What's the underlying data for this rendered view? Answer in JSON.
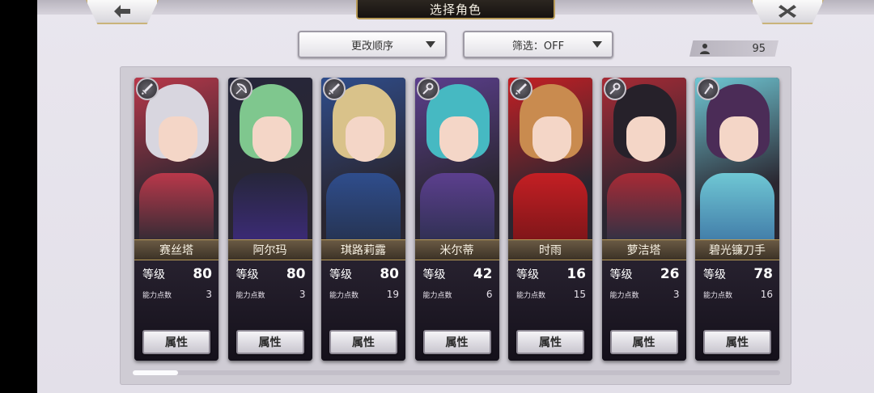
{
  "header": {
    "title": "选择角色",
    "back_icon": "arrow-left-icon",
    "close_icon": "close-icon"
  },
  "controls": {
    "sort_label": "更改顺序",
    "filter_label": "筛选：OFF",
    "unit_count": "95"
  },
  "labels": {
    "level": "等级",
    "ability_points": "能力点数",
    "attribute_button": "属性"
  },
  "characters": [
    {
      "name": "赛丝塔",
      "level": "80",
      "ability_points": "3",
      "weapon_icon": "sword-icon",
      "hair": "#d8d6df",
      "accent": "#b9384a",
      "outfit": "#2b2a33"
    },
    {
      "name": "阿尔玛",
      "level": "80",
      "ability_points": "3",
      "weapon_icon": "bow-icon",
      "hair": "#7fc78e",
      "accent": "#26263a",
      "outfit": "#3d2b7a"
    },
    {
      "name": "琪路莉露",
      "level": "80",
      "ability_points": "19",
      "weapon_icon": "sword-icon",
      "hair": "#d9c28a",
      "accent": "#2f4d8c",
      "outfit": "#25324f"
    },
    {
      "name": "米尔蒂",
      "level": "42",
      "ability_points": "6",
      "weapon_icon": "staff-icon",
      "hair": "#46b9c2",
      "accent": "#5c3f8e",
      "outfit": "#2d2f4f"
    },
    {
      "name": "时雨",
      "level": "16",
      "ability_points": "15",
      "weapon_icon": "sword-icon",
      "hair": "#c98b4f",
      "accent": "#c41f24",
      "outfit": "#7a1518"
    },
    {
      "name": "萝洁塔",
      "level": "26",
      "ability_points": "3",
      "weapon_icon": "staff-icon",
      "hair": "#26212a",
      "accent": "#a82a35",
      "outfit": "#2a3245"
    },
    {
      "name": "碧光镰刀手",
      "level": "78",
      "ability_points": "16",
      "weapon_icon": "axe-icon",
      "hair": "#4b2c57",
      "accent": "#6fc7d4",
      "outfit": "#3f78a6"
    }
  ],
  "scrollbar": {
    "position_fraction": 0.0
  }
}
